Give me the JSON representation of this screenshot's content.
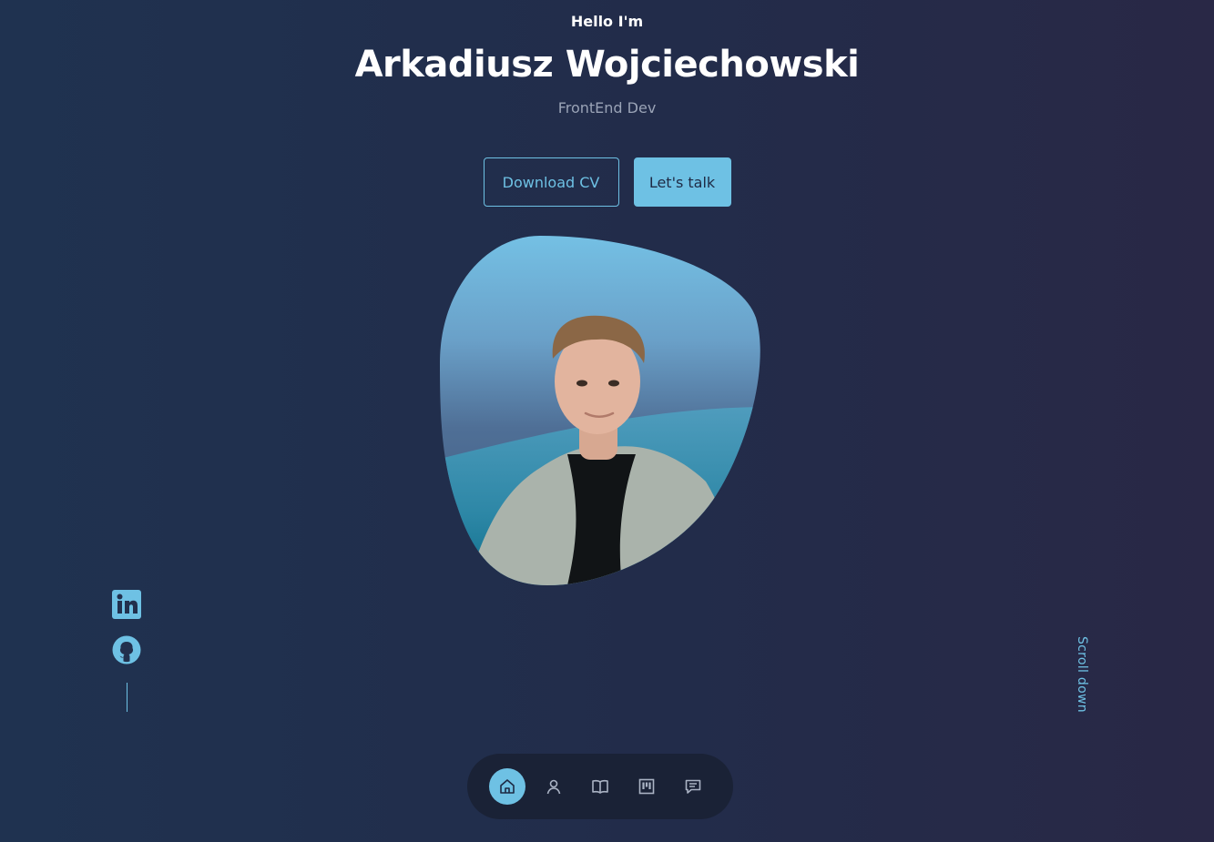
{
  "hero": {
    "greeting": "Hello I'm",
    "name": "Arkadiusz Wojciechowski",
    "role": "FrontEnd Dev"
  },
  "buttons": {
    "download_cv": "Download CV",
    "lets_talk": "Let's talk"
  },
  "social": {
    "items": [
      {
        "icon": "linkedin-icon"
      },
      {
        "icon": "github-icon"
      }
    ]
  },
  "scroll": {
    "label": "Scroll down"
  },
  "nav": {
    "items": [
      {
        "icon": "home-icon",
        "active": true
      },
      {
        "icon": "user-icon",
        "active": false
      },
      {
        "icon": "book-icon",
        "active": false
      },
      {
        "icon": "portfolio-icon",
        "active": false
      },
      {
        "icon": "message-icon",
        "active": false
      }
    ]
  },
  "colors": {
    "accent": "#6ec1e4",
    "background_start": "#1f3250",
    "background_end": "#292846",
    "nav_background": "#1a2236",
    "muted_text": "#9aa3b6"
  }
}
